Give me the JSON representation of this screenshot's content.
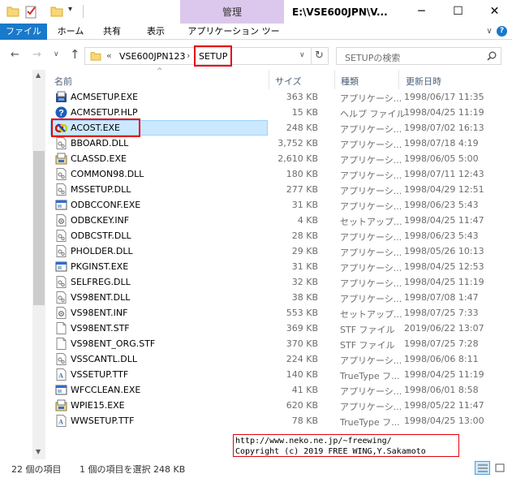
{
  "window": {
    "title": "E:\\VSE600JPN\\V...",
    "manage_tab": "管理",
    "minimize": "─",
    "maximize": "☐",
    "close": "✕",
    "expand": "∨",
    "help": "?"
  },
  "ribbon": {
    "tabs": [
      "ファイル",
      "ホーム",
      "共有",
      "表示",
      "アプリケーション ツール"
    ]
  },
  "address": {
    "overflow": "«",
    "parent": "VSE600JPN123",
    "separator": "›",
    "current": "SETUP",
    "dropdown": "∨",
    "refresh": "↻"
  },
  "search": {
    "placeholder": "SETUPの検索"
  },
  "columns": {
    "name": "名前",
    "size": "サイズ",
    "type": "種類",
    "modified": "更新日時"
  },
  "files": [
    {
      "name": "ACMSETUP.EXE",
      "size": "363 KB",
      "type": "アプリケーシ...",
      "date": "1998/06/17 11:35",
      "icon": "exe-icon"
    },
    {
      "name": "ACMSETUP.HLP",
      "size": "15 KB",
      "type": "ヘルプ ファイル",
      "date": "1998/04/25 11:19",
      "icon": "help-file-icon"
    },
    {
      "name": "ACOST.EXE",
      "size": "248 KB",
      "type": "アプリケーシ...",
      "date": "1998/07/02 16:13",
      "icon": "acost-exe-icon",
      "selected": true
    },
    {
      "name": "BBOARD.DLL",
      "size": "3,752 KB",
      "type": "アプリケーシ...",
      "date": "1998/07/18 4:19",
      "icon": "dll-icon"
    },
    {
      "name": "CLASSD.EXE",
      "size": "2,610 KB",
      "type": "アプリケーシ...",
      "date": "1998/06/05 5:00",
      "icon": "setup-exe-icon"
    },
    {
      "name": "COMMON98.DLL",
      "size": "180 KB",
      "type": "アプリケーシ...",
      "date": "1998/07/11 12:43",
      "icon": "dll-icon"
    },
    {
      "name": "MSSETUP.DLL",
      "size": "277 KB",
      "type": "アプリケーシ...",
      "date": "1998/04/29 12:51",
      "icon": "dll-icon"
    },
    {
      "name": "ODBCCONF.EXE",
      "size": "31 KB",
      "type": "アプリケーシ...",
      "date": "1998/06/23 5:43",
      "icon": "window-exe-icon"
    },
    {
      "name": "ODBCKEY.INF",
      "size": "4 KB",
      "type": "セットアップ...",
      "date": "1998/04/25 11:47",
      "icon": "inf-icon"
    },
    {
      "name": "ODBCSTF.DLL",
      "size": "28 KB",
      "type": "アプリケーシ...",
      "date": "1998/06/23 5:43",
      "icon": "dll-icon"
    },
    {
      "name": "PHOLDER.DLL",
      "size": "29 KB",
      "type": "アプリケーシ...",
      "date": "1998/05/26 10:13",
      "icon": "dll-icon"
    },
    {
      "name": "PKGINST.EXE",
      "size": "31 KB",
      "type": "アプリケーシ...",
      "date": "1998/04/25 12:53",
      "icon": "window-exe-icon"
    },
    {
      "name": "SELFREG.DLL",
      "size": "32 KB",
      "type": "アプリケーシ...",
      "date": "1998/04/25 11:19",
      "icon": "dll-icon"
    },
    {
      "name": "VS98ENT.DLL",
      "size": "38 KB",
      "type": "アプリケーシ...",
      "date": "1998/07/08 1:47",
      "icon": "dll-icon"
    },
    {
      "name": "VS98ENT.INF",
      "size": "553 KB",
      "type": "セットアップ...",
      "date": "1998/07/25 7:33",
      "icon": "inf-icon"
    },
    {
      "name": "VS98ENT.STF",
      "size": "369 KB",
      "type": "STF ファイル",
      "date": "2019/06/22 13:07",
      "icon": "blank-file-icon"
    },
    {
      "name": "VS98ENT_ORG.STF",
      "size": "370 KB",
      "type": "STF ファイル",
      "date": "1998/07/25 7:28",
      "icon": "blank-file-icon"
    },
    {
      "name": "VSSCANTL.DLL",
      "size": "224 KB",
      "type": "アプリケーシ...",
      "date": "1998/06/06 8:11",
      "icon": "dll-icon"
    },
    {
      "name": "VSSETUP.TTF",
      "size": "140 KB",
      "type": "TrueType フ...",
      "date": "1998/04/25 11:19",
      "icon": "font-file-icon"
    },
    {
      "name": "WFCCLEAN.EXE",
      "size": "41 KB",
      "type": "アプリケーシ...",
      "date": "1998/06/01 8:58",
      "icon": "window-exe-icon"
    },
    {
      "name": "WPIE15.EXE",
      "size": "620 KB",
      "type": "アプリケーシ...",
      "date": "1998/05/22 11:47",
      "icon": "setup-exe-icon"
    },
    {
      "name": "WWSETUP.TTF",
      "size": "78 KB",
      "type": "TrueType フ...",
      "date": "1998/04/25 13:00",
      "icon": "font-file-icon"
    }
  ],
  "status": {
    "count": "22 個の項目",
    "selection": "1 個の項目を選択  248 KB"
  },
  "watermark": {
    "line1": "http://www.neko.ne.jp/~freewing/",
    "line2": "Copyright (c) 2019 FREE WING,Y.Sakamoto"
  },
  "colors": {
    "file_tab": "#1979ca",
    "manage_tab": "#dcc8ec",
    "selection": "#cce8ff",
    "highlight_box": "#e5000b"
  }
}
